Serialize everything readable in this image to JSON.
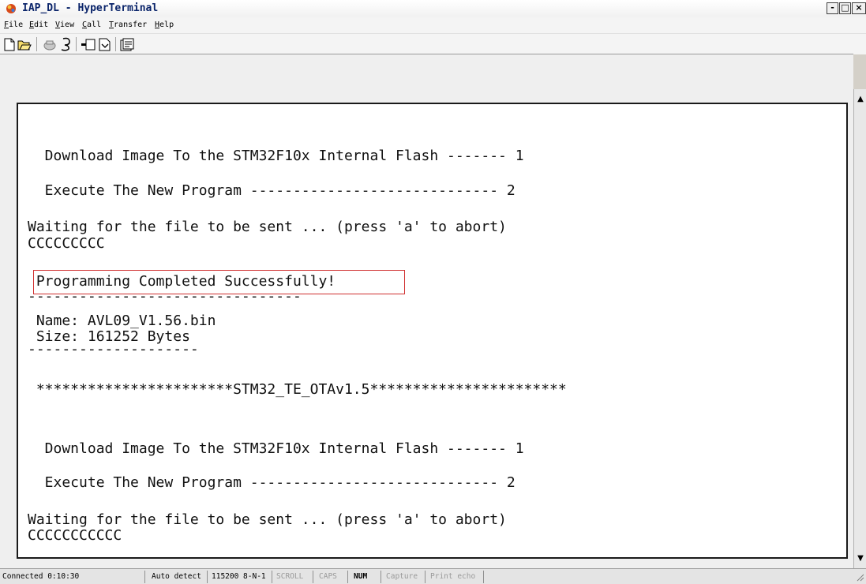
{
  "window": {
    "title": "IAP_DL - HyperTerminal",
    "buttons": {
      "minimize": "-",
      "maximize": "□",
      "close": "×"
    }
  },
  "menu": {
    "items": [
      {
        "label": "File",
        "accel": "F"
      },
      {
        "label": "Edit",
        "accel": "E"
      },
      {
        "label": "View",
        "accel": "V"
      },
      {
        "label": "Call",
        "accel": "C"
      },
      {
        "label": "Transfer",
        "accel": "T"
      },
      {
        "label": "Help",
        "accel": "H"
      }
    ]
  },
  "toolbar": {
    "icons": [
      "new-icon",
      "open-icon",
      "disconnect-icon",
      "connect-icon",
      "send-icon",
      "receive-icon",
      "properties-icon"
    ]
  },
  "terminal": {
    "lines": {
      "l1": "  Download Image To the STM32F10x Internal Flash ------- 1",
      "l2": "  Execute The New Program ----------------------------- 2",
      "l3": "Waiting for the file to be sent ... (press 'a' to abort)",
      "l4": "CCCCCCCCC",
      "l5": " Programming Completed Successfully!",
      "l6": "--------------------------------",
      "l7": " Name: AVL09_V1.56.bin",
      "l8": " Size: 161252 Bytes",
      "l9": "--------------------",
      "l10": " ***********************STM32_TE_OTAv1.5***********************",
      "l11": "  Download Image To the STM32F10x Internal Flash ------- 1",
      "l12": "  Execute The New Program ----------------------------- 2",
      "l13": "Waiting for the file to be sent ... (press 'a' to abort)",
      "l14": "CCCCCCCCCCC"
    }
  },
  "status": {
    "connected": "Connected 0:10:30",
    "detect": "Auto detect",
    "port": "115200 8-N-1",
    "scroll": "SCROLL",
    "caps": "CAPS",
    "num": "NUM",
    "capture": "Capture",
    "print_echo": "Print echo"
  },
  "colors": {
    "title_text": "#0a246a",
    "highlight_border": "#d03030",
    "terminal_bg": "#ffffff"
  }
}
